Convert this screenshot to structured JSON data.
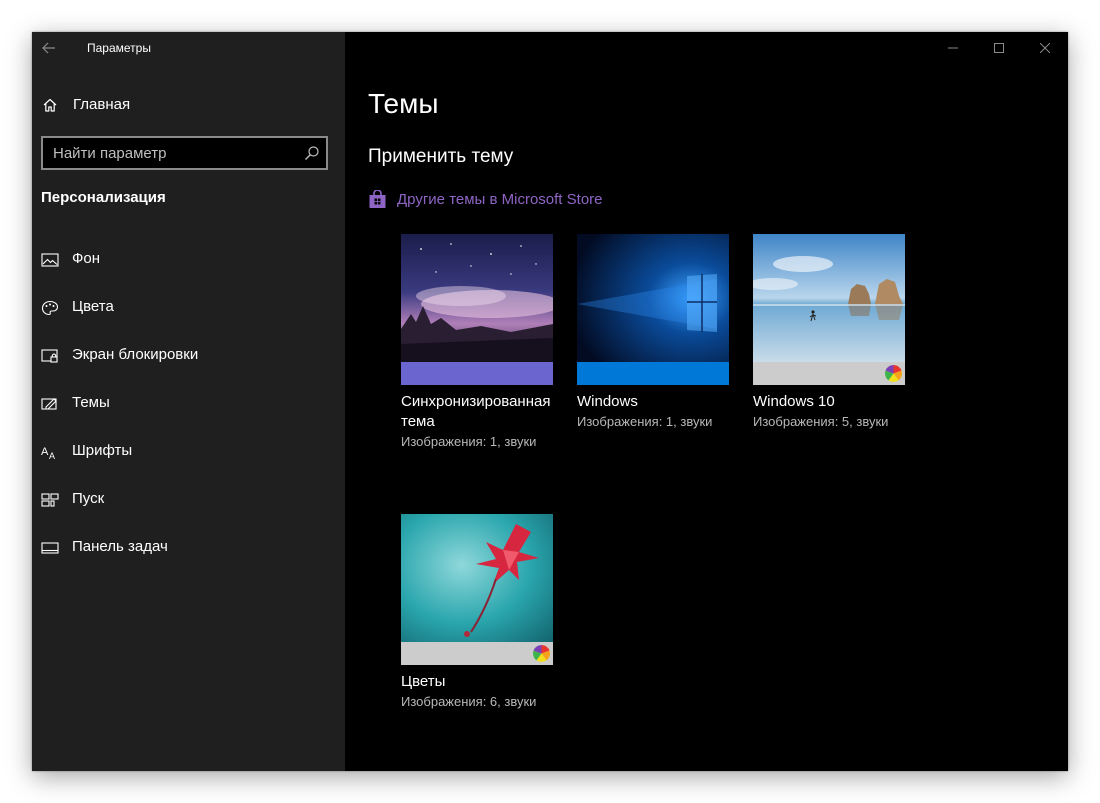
{
  "window": {
    "title": "Параметры"
  },
  "sidebar": {
    "home_label": "Главная",
    "search": {
      "placeholder": "Найти параметр",
      "value": ""
    },
    "section_title": "Персонализация",
    "items": [
      {
        "label": "Фон",
        "icon": "picture-icon"
      },
      {
        "label": "Цвета",
        "icon": "palette-icon"
      },
      {
        "label": "Экран блокировки",
        "icon": "lock-screen-icon"
      },
      {
        "label": "Темы",
        "icon": "brush-icon"
      },
      {
        "label": "Шрифты",
        "icon": "font-icon"
      },
      {
        "label": "Пуск",
        "icon": "start-tiles-icon"
      },
      {
        "label": "Панель задач",
        "icon": "taskbar-icon"
      }
    ]
  },
  "main": {
    "title": "Темы",
    "subheading": "Применить тему",
    "store_link": "Другие темы в Microsoft Store",
    "themes": [
      {
        "name": "Синхронизированная тема",
        "desc": "Изображения: 1, звуки",
        "bar_color": "#6b66cf"
      },
      {
        "name": "Windows",
        "desc": "Изображения: 1, звуки",
        "bar_color": "#0078d7"
      },
      {
        "name": "Windows 10",
        "desc": "Изображения: 5, звуки",
        "bar_color": "#cccccc"
      },
      {
        "name": "Цветы",
        "desc": "Изображения: 6, звуки",
        "bar_color": "#cccccc"
      }
    ]
  },
  "colors": {
    "accent_link": "#8e65c4",
    "sidebar_bg": "#1f1f1f",
    "main_bg": "#000000"
  }
}
